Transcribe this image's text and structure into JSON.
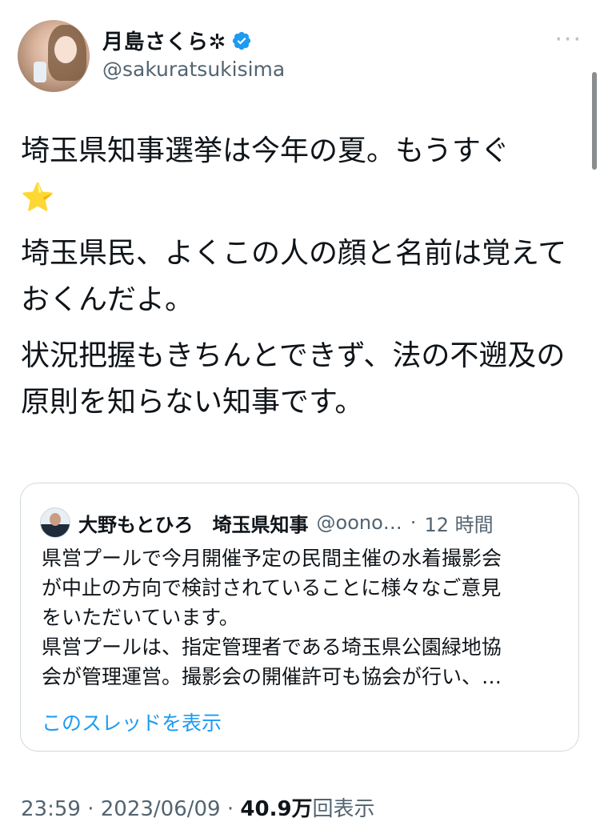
{
  "author": {
    "display_name": "月島さくら✲",
    "handle": "@sakuratsukisima"
  },
  "tweet": {
    "paragraphs": [
      "埼玉県知事選挙は今年の夏。もうすぐ",
      "埼玉県民、よくこの人の顔と名前は覚えておくんだよ。",
      "状況把握もきちんとできず、法の不遡及の原則を知らない知事です。"
    ],
    "emoji": "⭐"
  },
  "quoted": {
    "name": "大野もとひろ　埼玉県知事",
    "handle": "@oono…",
    "separator": "·",
    "time": "12 時間",
    "lines": [
      "県営プールで今月開催予定の民間主催の水着撮影会",
      "が中止の方向で検討されていることに様々なご意見",
      "をいただいています。",
      "県営プールは、指定管理者である埼玉県公園緑地協",
      "会が管理運営。撮影会の開催許可も協会が行い、…"
    ],
    "thread_link": "このスレッドを表示"
  },
  "meta": {
    "time": "23:59",
    "date": "2023/06/09",
    "views": "40.9万",
    "views_label": "回表示"
  },
  "colors": {
    "accent": "#1d9bf0",
    "secondary_text": "#536471",
    "border": "#cfd9de"
  },
  "icons": {
    "verified": "verified-badge-icon",
    "more": "more-options-icon"
  }
}
